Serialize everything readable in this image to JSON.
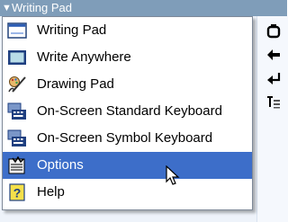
{
  "window": {
    "title": "Writing Pad"
  },
  "menu": {
    "items": [
      {
        "label": "Writing Pad",
        "icon": "writing-pad-icon"
      },
      {
        "label": "Write Anywhere",
        "icon": "write-anywhere-icon"
      },
      {
        "label": "Drawing Pad",
        "icon": "drawing-pad-icon"
      },
      {
        "label": "On-Screen Standard Keyboard",
        "icon": "keyboard-icon"
      },
      {
        "label": "On-Screen Symbol Keyboard",
        "icon": "symbol-keyboard-icon"
      },
      {
        "label": "Options",
        "icon": "options-icon",
        "selected": true
      },
      {
        "label": "Help",
        "icon": "help-icon"
      }
    ]
  },
  "colors": {
    "selection": "#3d6ec9",
    "titlebar": "#7f9db9",
    "menu_border": "#7f8a99"
  }
}
